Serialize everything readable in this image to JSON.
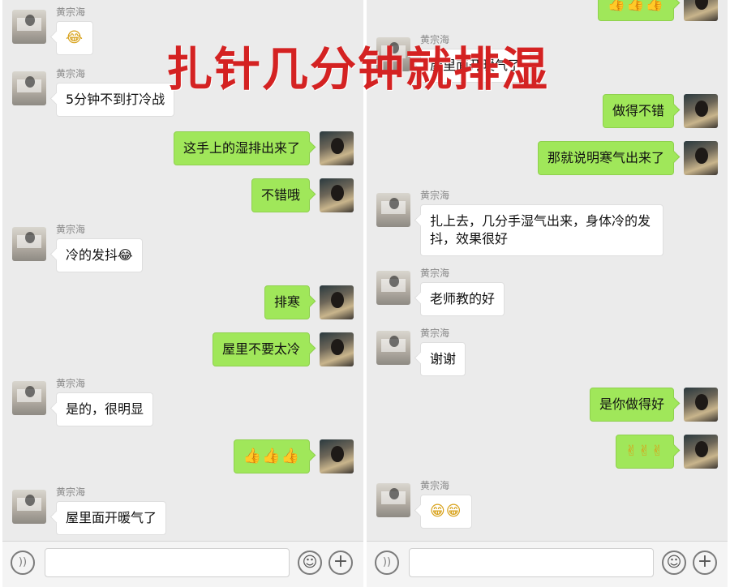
{
  "overlay_title": "扎针几分钟就排湿",
  "left_chat": {
    "messages": [
      {
        "dir": "in",
        "sender": "黄宗海",
        "text": "😂"
      },
      {
        "dir": "in",
        "sender": "黄宗海",
        "text": "5分钟不到打冷战"
      },
      {
        "dir": "out",
        "text": "这手上的湿排出来了"
      },
      {
        "dir": "out",
        "text": "不错哦"
      },
      {
        "dir": "in",
        "sender": "黄宗海",
        "text": "冷的发抖😂"
      },
      {
        "dir": "out",
        "text": "排寒"
      },
      {
        "dir": "out",
        "text": "屋里不要太冷"
      },
      {
        "dir": "in",
        "sender": "黄宗海",
        "text": "是的，很明显"
      },
      {
        "dir": "out",
        "text": "👍👍👍"
      },
      {
        "dir": "in",
        "sender": "黄宗海",
        "text": "屋里面开暖气了"
      }
    ]
  },
  "right_chat": {
    "messages": [
      {
        "dir": "out",
        "text": "👍👍👍"
      },
      {
        "dir": "in",
        "sender": "黄宗海",
        "text": "屋里面开暖气了"
      },
      {
        "dir": "out",
        "text": "做得不错"
      },
      {
        "dir": "out",
        "text": "那就说明寒气出来了"
      },
      {
        "dir": "in",
        "sender": "黄宗海",
        "text": "扎上去，几分手湿气出来，身体冷的发抖，效果很好"
      },
      {
        "dir": "in",
        "sender": "黄宗海",
        "text": "老师教的好"
      },
      {
        "dir": "in",
        "sender": "黄宗海",
        "text": "谢谢"
      },
      {
        "dir": "out",
        "text": "是你做得好"
      },
      {
        "dir": "out",
        "text": "✌✌✌"
      },
      {
        "dir": "in",
        "sender": "黄宗海",
        "text": "😁😁"
      }
    ]
  },
  "input_bar": {
    "voice_icon": "voice-icon",
    "emoji_icon": "emoji-icon",
    "plus_icon": "plus-icon"
  },
  "colors": {
    "chat_bg": "#ebebeb",
    "outgoing_bubble": "#a0e75a",
    "incoming_bubble": "#ffffff",
    "overlay_text": "#d42222"
  }
}
